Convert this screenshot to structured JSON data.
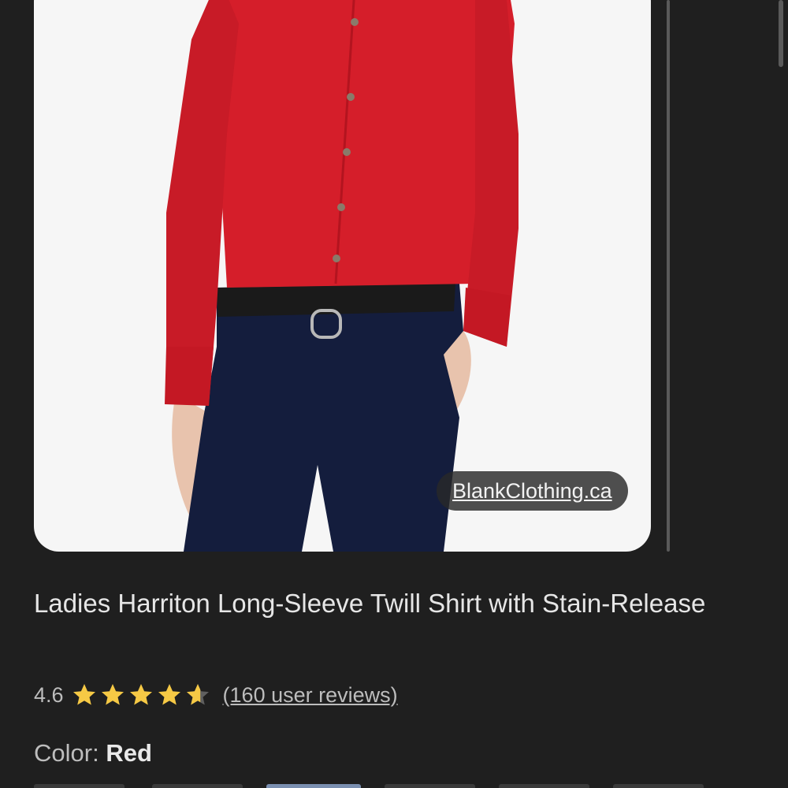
{
  "product": {
    "image_source": "BlankClothing.ca",
    "title": "Ladies Harriton Long-Sleeve Twill Shirt with Stain-Release",
    "rating_value": "4.6",
    "rating": 4.6,
    "rating_max": 5,
    "reviews_link": "(160 user reviews)",
    "color_label": "Color:",
    "color_value": "Red"
  },
  "colors": {
    "background": "#1f1f1f",
    "star": "#f6c945",
    "shirt": "#d51e2a",
    "pants": "#141d3d"
  }
}
